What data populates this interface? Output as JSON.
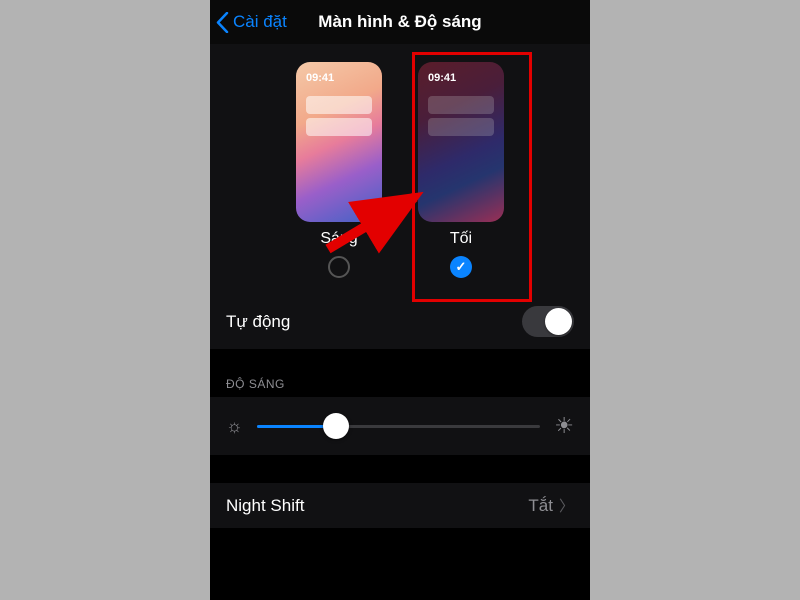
{
  "navbar": {
    "back_label": "Cài đặt",
    "title": "Màn hình & Độ sáng"
  },
  "appearance": {
    "time": "09:41",
    "light_label": "Sáng",
    "dark_label": "Tối",
    "selected": "dark"
  },
  "automatic": {
    "label": "Tự động",
    "enabled": false
  },
  "brightness": {
    "header": "ĐỘ SÁNG",
    "value_percent": 28
  },
  "night_shift": {
    "label": "Night Shift",
    "value": "Tắt"
  },
  "annotation": {
    "highlight": "dark-option",
    "arrow": true
  }
}
